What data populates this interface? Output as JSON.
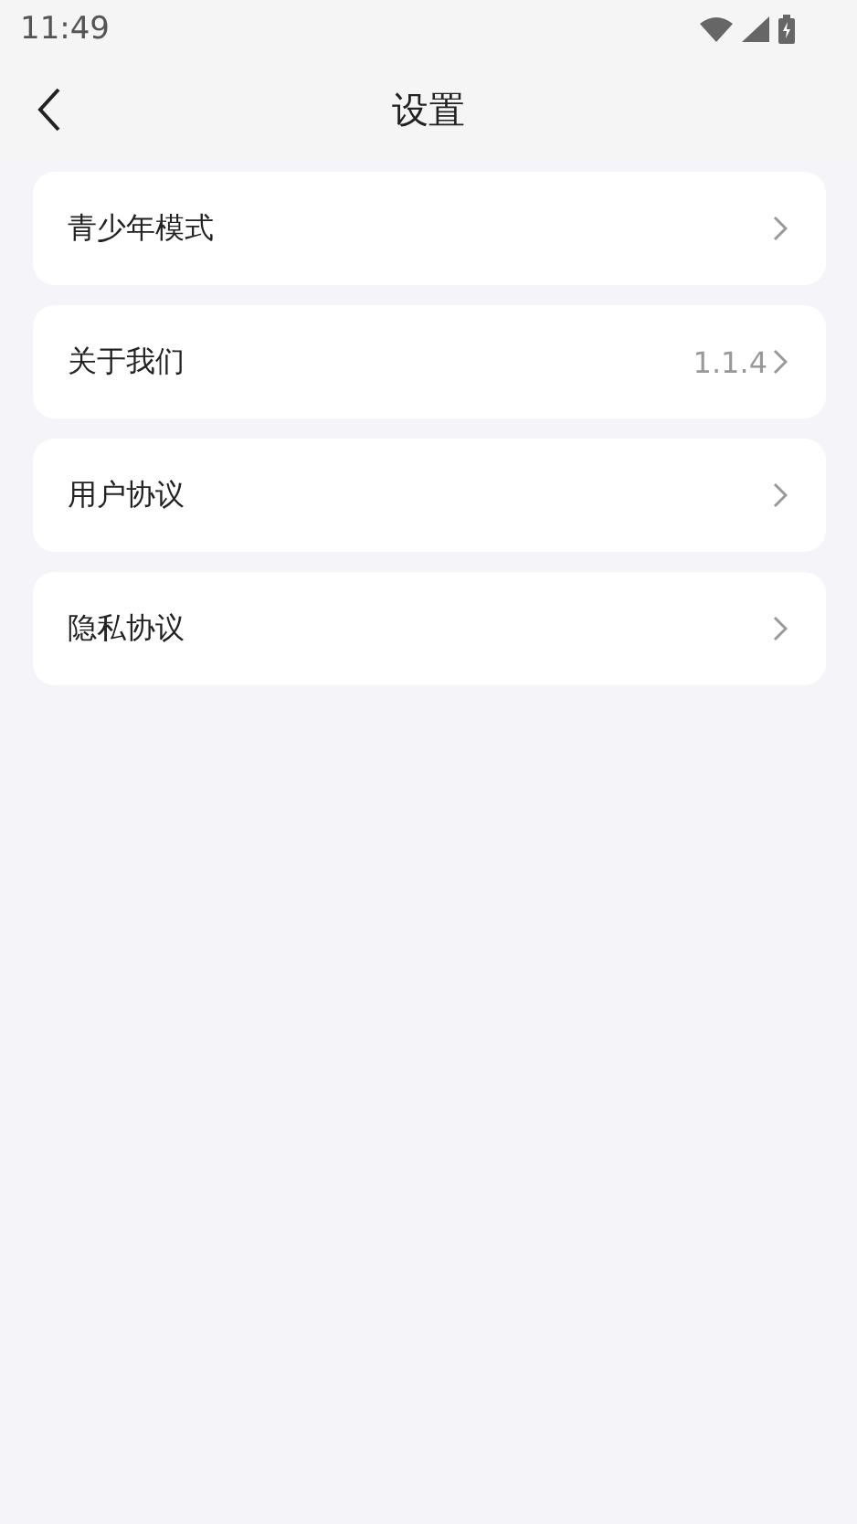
{
  "status_bar": {
    "time": "11:49"
  },
  "header": {
    "title": "设置"
  },
  "items": [
    {
      "label": "青少年模式"
    },
    {
      "label": "关于我们",
      "value": "1.1.4"
    },
    {
      "label": "用户协议"
    },
    {
      "label": "隐私协议"
    }
  ]
}
